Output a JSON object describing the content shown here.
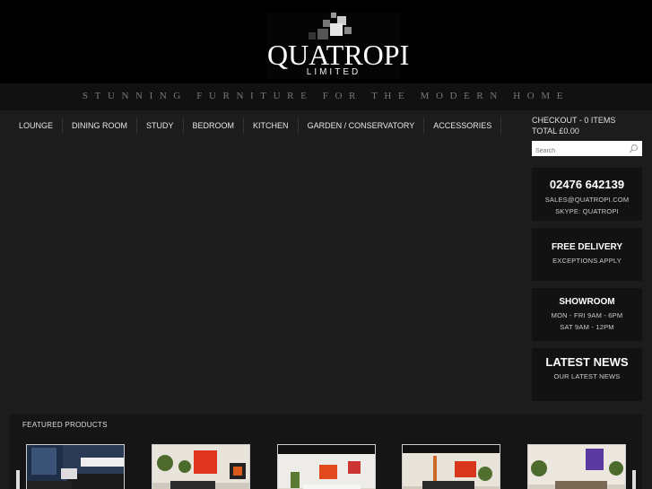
{
  "header": {
    "logo_name": "QUATROPI",
    "logo_sub": "LIMITED",
    "tagline": "STUNNING FURNITURE FOR THE MODERN HOME"
  },
  "nav": {
    "items": [
      {
        "label": "LOUNGE"
      },
      {
        "label": "DINING ROOM"
      },
      {
        "label": "STUDY"
      },
      {
        "label": "BEDROOM"
      },
      {
        "label": "KITCHEN"
      },
      {
        "label": "GARDEN / CONSERVATORY"
      },
      {
        "label": "ACCESSORIES"
      }
    ]
  },
  "sidebar": {
    "checkout_label": "CHECKOUT - 0 ITEMS",
    "total_label": "TOTAL £0.00",
    "search_placeholder": "Search",
    "contact": {
      "phone": "02476 642139",
      "email": "SALES@QUATROPI.COM",
      "skype": "SKYPE: QUATROPI"
    },
    "delivery": {
      "title": "FREE DELIVERY",
      "subtitle": "EXCEPTIONS APPLY"
    },
    "showroom": {
      "title": "SHOWROOM",
      "hours_weekday": "MON - FRI 9AM - 6PM",
      "hours_sat": "SAT 9AM - 12PM"
    },
    "news": {
      "title": "LATEST NEWS",
      "subtitle": "OUR LATEST NEWS"
    }
  },
  "featured": {
    "title": "FEATURED PRODUCTS"
  },
  "colors": {
    "header_bg": "#000000",
    "page_bg": "#1c1c1c",
    "box_bg": "#121212"
  }
}
